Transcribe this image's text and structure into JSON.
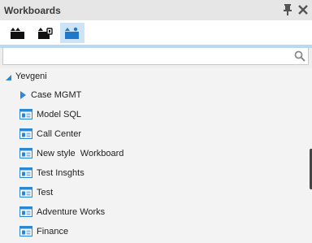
{
  "panel": {
    "title": "Workboards"
  },
  "header_icons": [
    "pin-icon",
    "close-icon"
  ],
  "tabs": [
    {
      "icon": "clapperboard-icon",
      "active": false
    },
    {
      "icon": "secure-board-icon",
      "active": false
    },
    {
      "icon": "shared-board-icon",
      "active": true
    }
  ],
  "search": {
    "placeholder": "",
    "value": ""
  },
  "tree": {
    "root": {
      "label": "Yevgeni",
      "expanded": true
    },
    "items": [
      {
        "label": "Case MGMT",
        "type": "folder",
        "expanded": false
      },
      {
        "label": "Model SQL",
        "type": "workboard"
      },
      {
        "label": "Call Center",
        "type": "workboard"
      },
      {
        "label": "New style  Workboard",
        "type": "workboard"
      },
      {
        "label": "Test Insghts",
        "type": "workboard"
      },
      {
        "label": "Test",
        "type": "workboard"
      },
      {
        "label": "Adventure Works",
        "type": "workboard"
      },
      {
        "label": "Finance",
        "type": "workboard"
      }
    ]
  },
  "colors": {
    "accent": "#2a88d8",
    "tab_active": "#cfe3f6",
    "strip": "#b9d8f2"
  }
}
